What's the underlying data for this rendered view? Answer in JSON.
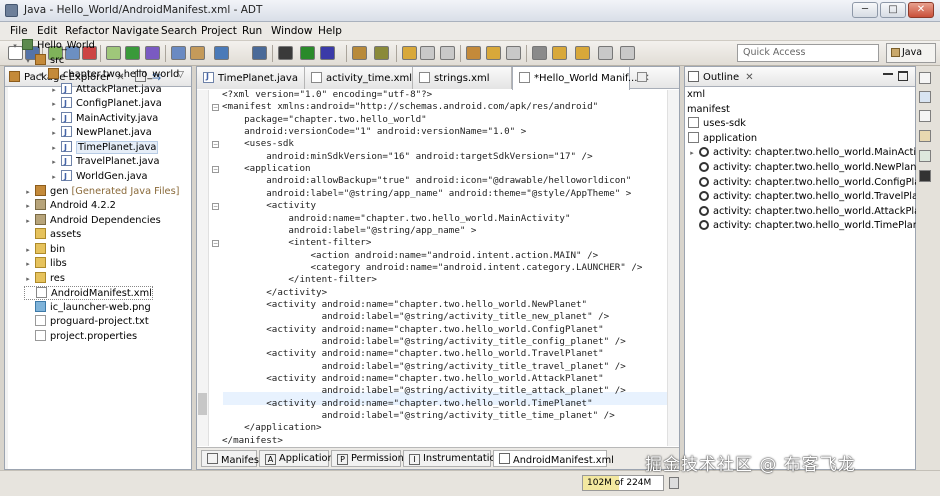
{
  "window": {
    "title": "Java - Hello_World/AndroidManifest.xml - ADT",
    "min": "─",
    "max": "□",
    "close": "✕"
  },
  "menu": [
    "File",
    "Edit",
    "Refactor",
    "Navigate",
    "Search",
    "Project",
    "Run",
    "Window",
    "Help"
  ],
  "toolbar": {
    "quick_access": "Quick Access",
    "perspective": "Java"
  },
  "package_explorer": {
    "title": "Package Explorer",
    "tree": [
      {
        "label": "Hello_World",
        "icon": "project-icon",
        "indent": 0,
        "twisty": "▾"
      },
      {
        "label": "src",
        "icon": "source-folder-icon",
        "indent": 1,
        "twisty": "▾"
      },
      {
        "label": "chapter.two.hello_world",
        "icon": "package-icon",
        "indent": 2,
        "twisty": "▾"
      },
      {
        "label": "AttackPlanet.java",
        "icon": "java-file-icon",
        "indent": 3,
        "twisty": "▸"
      },
      {
        "label": "ConfigPlanet.java",
        "icon": "java-file-icon",
        "indent": 3,
        "twisty": "▸"
      },
      {
        "label": "MainActivity.java",
        "icon": "java-file-icon",
        "indent": 3,
        "twisty": "▸"
      },
      {
        "label": "NewPlanet.java",
        "icon": "java-file-icon",
        "indent": 3,
        "twisty": "▸"
      },
      {
        "label": "TimePlanet.java",
        "icon": "java-file-icon",
        "indent": 3,
        "twisty": "▸",
        "selected": true
      },
      {
        "label": "TravelPlanet.java",
        "icon": "java-file-icon",
        "indent": 3,
        "twisty": "▸"
      },
      {
        "label": "WorldGen.java",
        "icon": "java-file-icon",
        "indent": 3,
        "twisty": "▸"
      },
      {
        "label": "gen",
        "suffix": "[Generated Java Files]",
        "icon": "gen-folder-icon",
        "indent": 1,
        "twisty": "▸"
      },
      {
        "label": "Android 4.2.2",
        "icon": "library-icon",
        "indent": 1,
        "twisty": "▸"
      },
      {
        "label": "Android Dependencies",
        "icon": "library-icon",
        "indent": 1,
        "twisty": "▸"
      },
      {
        "label": "assets",
        "icon": "folder-icon",
        "indent": 1,
        "twisty": ""
      },
      {
        "label": "bin",
        "icon": "folder-icon",
        "indent": 1,
        "twisty": "▸"
      },
      {
        "label": "libs",
        "icon": "folder-icon",
        "indent": 1,
        "twisty": "▸"
      },
      {
        "label": "res",
        "icon": "folder-icon",
        "indent": 1,
        "twisty": "▸"
      },
      {
        "label": "AndroidManifest.xml",
        "icon": "xml-file-icon",
        "indent": 1,
        "twisty": "",
        "boxed": true
      },
      {
        "label": "ic_launcher-web.png",
        "icon": "image-file-icon",
        "indent": 1,
        "twisty": ""
      },
      {
        "label": "proguard-project.txt",
        "icon": "text-file-icon",
        "indent": 1,
        "twisty": ""
      },
      {
        "label": "project.properties",
        "icon": "text-file-icon",
        "indent": 1,
        "twisty": ""
      }
    ]
  },
  "editor": {
    "tabs": [
      {
        "label": "TimePlanet.java",
        "icon": "java-file-icon"
      },
      {
        "label": "activity_time.xml",
        "icon": "xml-file-icon"
      },
      {
        "label": "strings.xml",
        "icon": "xml-file-icon"
      },
      {
        "label": "*Hello_World Manif...",
        "icon": "android-manifest-icon",
        "active": true
      }
    ],
    "lines": [
      "<?xml version=\"1.0\" encoding=\"utf-8\"?>",
      "<manifest xmlns:android=\"http://schemas.android.com/apk/res/android\"",
      "    package=\"chapter.two.hello_world\"",
      "    android:versionCode=\"1\" android:versionName=\"1.0\" >",
      "    <uses-sdk",
      "        android:minSdkVersion=\"16\" android:targetSdkVersion=\"17\" />",
      "    <application",
      "        android:allowBackup=\"true\" android:icon=\"@drawable/helloworldicon\"",
      "        android:label=\"@string/app_name\" android:theme=\"@style/AppTheme\" >",
      "        <activity",
      "            android:name=\"chapter.two.hello_world.MainActivity\"",
      "            android:label=\"@string/app_name\" >",
      "            <intent-filter>",
      "                <action android:name=\"android.intent.action.MAIN\" />",
      "                <category android:name=\"android.intent.category.LAUNCHER\" />",
      "            </intent-filter>",
      "        </activity>",
      "        <activity android:name=\"chapter.two.hello_world.NewPlanet\"",
      "                  android:label=\"@string/activity_title_new_planet\" />",
      "        <activity android:name=\"chapter.two.hello_world.ConfigPlanet\"",
      "                  android:label=\"@string/activity_title_config_planet\" />",
      "        <activity android:name=\"chapter.two.hello_world.TravelPlanet\"",
      "                  android:label=\"@string/activity_title_travel_planet\" />",
      "        <activity android:name=\"chapter.two.hello_world.AttackPlanet\"",
      "                  android:label=\"@string/activity_title_attack_planet\" />",
      "        <activity android:name=\"chapter.two.hello_world.TimePlanet\"",
      "                  android:label=\"@string/activity_title_time_planet\" />",
      "    </application>",
      "</manifest>"
    ],
    "bottom_tabs": [
      {
        "label": "Manifest",
        "key": "",
        "icon": "manifest-icon"
      },
      {
        "label": "Application",
        "key": "A",
        "icon": "application-icon"
      },
      {
        "label": "Permissions",
        "key": "P",
        "icon": "permissions-icon"
      },
      {
        "label": "Instrumentation",
        "key": "I",
        "icon": "instrumentation-icon"
      },
      {
        "label": "AndroidManifest.xml",
        "key": "",
        "icon": "xml-file-icon",
        "active": true
      }
    ]
  },
  "outline": {
    "title": "Outline",
    "items": [
      {
        "label": "xml",
        "icon": "",
        "indent": 0
      },
      {
        "label": "manifest",
        "icon": "",
        "indent": 0
      },
      {
        "label": "uses-sdk",
        "icon": "element-icon",
        "indent": 0
      },
      {
        "label": "application",
        "icon": "element-icon",
        "indent": 0
      },
      {
        "label": "activity: chapter.two.hello_world.MainActivity",
        "icon": "activity-icon",
        "indent": 0,
        "twisty": "▸"
      },
      {
        "label": "activity: chapter.two.hello_world.NewPlanet",
        "icon": "activity-icon",
        "indent": 0
      },
      {
        "label": "activity: chapter.two.hello_world.ConfigPlanet",
        "icon": "activity-icon",
        "indent": 0
      },
      {
        "label": "activity: chapter.two.hello_world.TravelPlanet",
        "icon": "activity-icon",
        "indent": 0
      },
      {
        "label": "activity: chapter.two.hello_world.AttackPlanet",
        "icon": "activity-icon",
        "indent": 0
      },
      {
        "label": "activity: chapter.two.hello_world.TimePlanet",
        "icon": "activity-icon",
        "indent": 0
      }
    ]
  },
  "status": {
    "heap": "102M of 224M",
    "heap_used_fraction": 0.455
  },
  "watermark": "掘金技术社区 @ 布客飞龙"
}
